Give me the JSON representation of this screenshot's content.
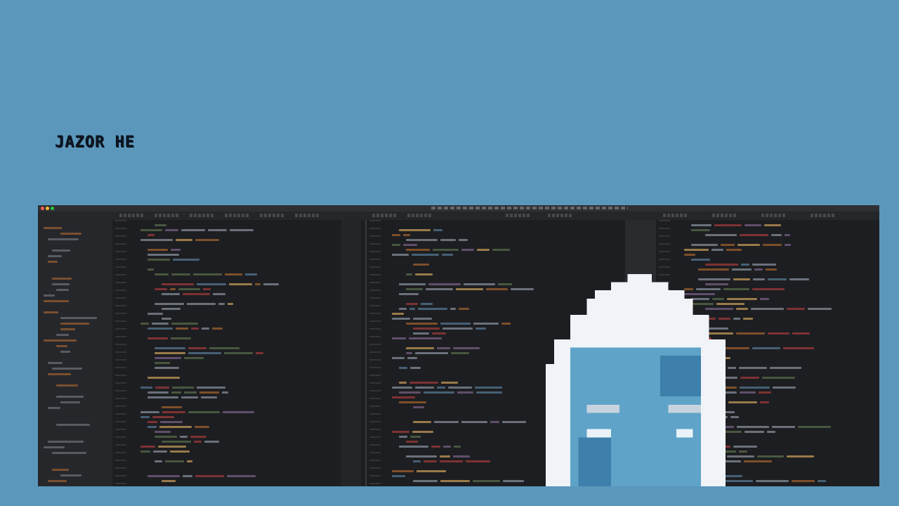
{
  "slide": {
    "title": "JAZOR HE"
  },
  "editor_screenshot": {
    "description_icon": "code-editor-screenshot",
    "theme_colors": {
      "background": "#1e1f22",
      "keyword": "#cc7832",
      "string": "#6a8759",
      "function": "#ffc66d",
      "number": "#6897bb",
      "text": "#a9b7c6"
    }
  },
  "avatar": {
    "icon": "pixel-avatar-icon",
    "colors": {
      "hat": "#f0f3f7",
      "face": "#5fa3c9",
      "shade": "#3e7fab"
    }
  }
}
